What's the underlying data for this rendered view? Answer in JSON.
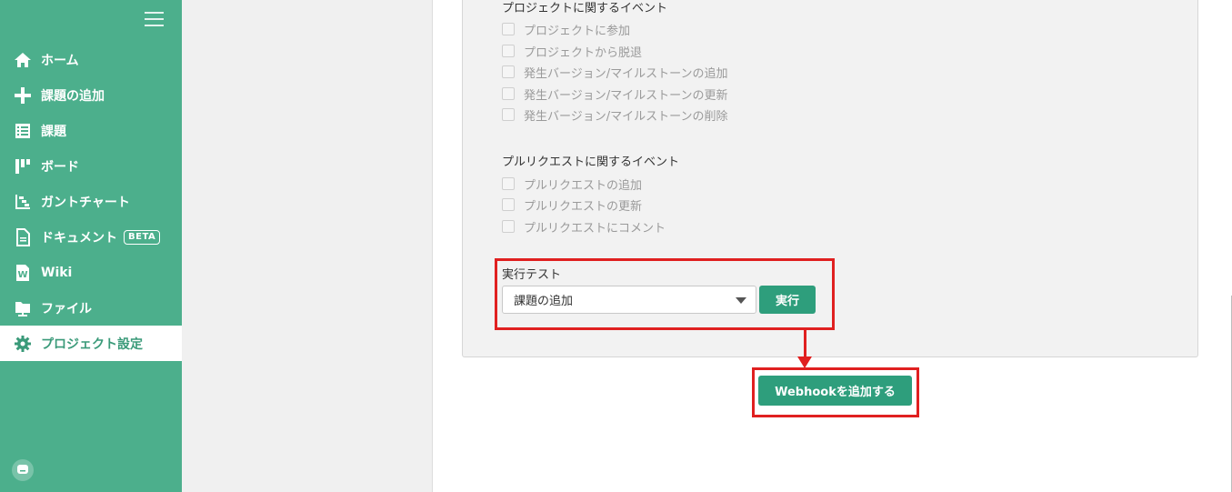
{
  "sidebar": {
    "items": [
      {
        "label": "ホーム",
        "icon": "home-icon"
      },
      {
        "label": "課題の追加",
        "icon": "plus-icon"
      },
      {
        "label": "課題",
        "icon": "list-icon"
      },
      {
        "label": "ボード",
        "icon": "board-icon"
      },
      {
        "label": "ガントチャート",
        "icon": "gantt-icon"
      },
      {
        "label": "ドキュメント",
        "icon": "document-icon",
        "badge": "BETA"
      },
      {
        "label": "Wiki",
        "icon": "wiki-icon"
      },
      {
        "label": "ファイル",
        "icon": "folder-icon"
      },
      {
        "label": "プロジェクト設定",
        "icon": "gear-icon",
        "active": true
      }
    ]
  },
  "events": {
    "project_section": {
      "title": "プロジェクトに関するイベント",
      "items": [
        "プロジェクトに参加",
        "プロジェクトから脱退",
        "発生バージョン/マイルストーンの追加",
        "発生バージョン/マイルストーンの更新",
        "発生バージョン/マイルストーンの削除"
      ]
    },
    "pr_section": {
      "title": "プルリクエストに関するイベント",
      "items": [
        "プルリクエストの追加",
        "プルリクエストの更新",
        "プルリクエストにコメント"
      ]
    }
  },
  "test": {
    "label": "実行テスト",
    "selected": "課題の追加",
    "run_label": "実行"
  },
  "submit": {
    "label": "Webhookを追加する"
  },
  "colors": {
    "sidebar": "#4caf8c",
    "accent": "#2e9e7c",
    "highlight": "#e02020"
  }
}
